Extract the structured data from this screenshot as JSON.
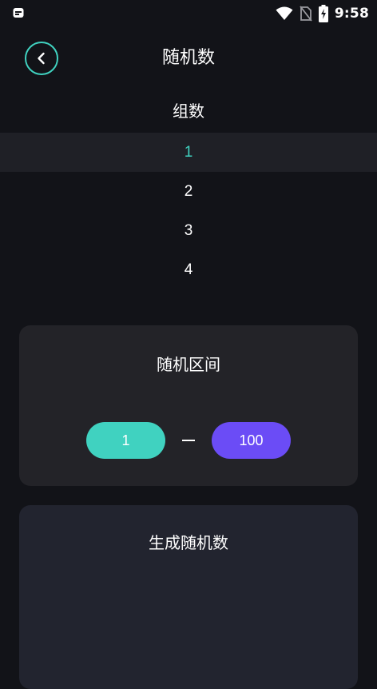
{
  "status_bar": {
    "time": "9:58",
    "icons": [
      "app-notification-icon",
      "wifi-icon",
      "no-sim-icon",
      "battery-charging-icon"
    ]
  },
  "header": {
    "title": "随机数",
    "back_icon": "chevron-left-icon"
  },
  "group_picker": {
    "label": "组数",
    "options": [
      "1",
      "2",
      "3",
      "4"
    ],
    "selected": "1"
  },
  "range": {
    "title": "随机区间",
    "min": "1",
    "max": "100",
    "separator": "—"
  },
  "generate": {
    "title": "生成随机数"
  },
  "colors": {
    "background": "#121318",
    "accent_teal": "#40d2c0",
    "accent_purple": "#6b4cf6",
    "card": "#232328",
    "card_generate": "#22242f"
  }
}
